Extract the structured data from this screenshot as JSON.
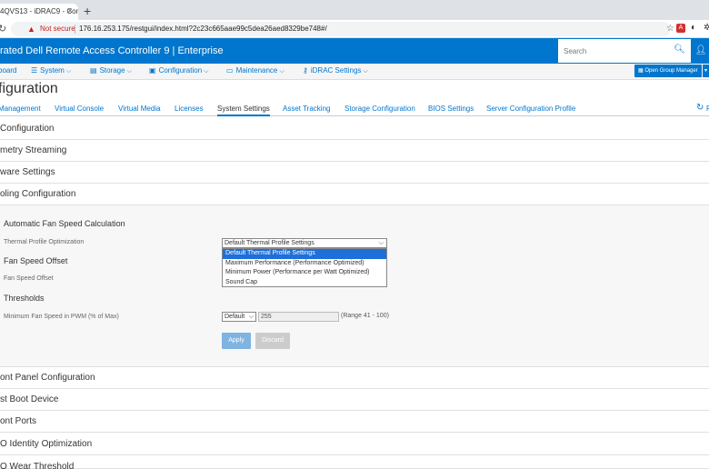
{
  "browser": {
    "tab_title": "4QVS13 - iDRAC9 - Con",
    "close_glyph": "×",
    "newtab_glyph": "+",
    "not_secure": "Not secure",
    "url": "176.16.253.175/restgui/index.html?2c23c665aae99c5dea26aed8329be748#/",
    "pdf_ext": "A"
  },
  "app": {
    "title": "rated Dell Remote Access Controller 9 | Enterprise",
    "search_placeholder": "Search"
  },
  "nav": {
    "items": [
      {
        "label": "board"
      },
      {
        "label": "System"
      },
      {
        "label": "Storage"
      },
      {
        "label": "Configuration"
      },
      {
        "label": "Maintenance"
      },
      {
        "label": "iDRAC Settings"
      }
    ],
    "group_button": "Open Group Manager"
  },
  "page_title": "figuration",
  "tabs": {
    "items": [
      "Management",
      "Virtual Console",
      "Virtual Media",
      "Licenses",
      "System Settings",
      "Asset Tracking",
      "Storage Configuration",
      "BIOS Settings",
      "Server Configuration Profile"
    ],
    "active": "System Settings",
    "refresh_label": "R"
  },
  "sections_top": [
    "Configuration",
    "metry Streaming",
    "ware Settings",
    "oling Configuration"
  ],
  "cooling": {
    "auto_fan_heading": "Automatic Fan Speed Calculation",
    "thermal_label": "Thermal Profile Optimization",
    "thermal_selected": "Default Thermal Profile Settings",
    "thermal_options": [
      "Default Thermal Profile Settings",
      "Maximum Performance (Performance Optimized)",
      "Minimum Power (Performance per Watt Optimized)",
      "Sound Cap"
    ],
    "fan_offset_heading": "Fan Speed Offset",
    "fan_offset_label": "Fan Speed Offset",
    "thresholds_heading": "Thresholds",
    "min_fan_label": "Minimum Fan Speed in PWM (% of Max)",
    "min_fan_mode": "Default",
    "min_fan_value": "255",
    "min_fan_range": "(Range 41 - 100)",
    "apply_label": "Apply",
    "discard_label": "Discard"
  },
  "sections_bottom": [
    "ont Panel Configuration",
    "st Boot Device",
    "ont Ports",
    "O Identity Optimization",
    "O Wear Threshold"
  ],
  "colors": {
    "brand": "#0076ce",
    "highlight": "#1e6fd9"
  }
}
